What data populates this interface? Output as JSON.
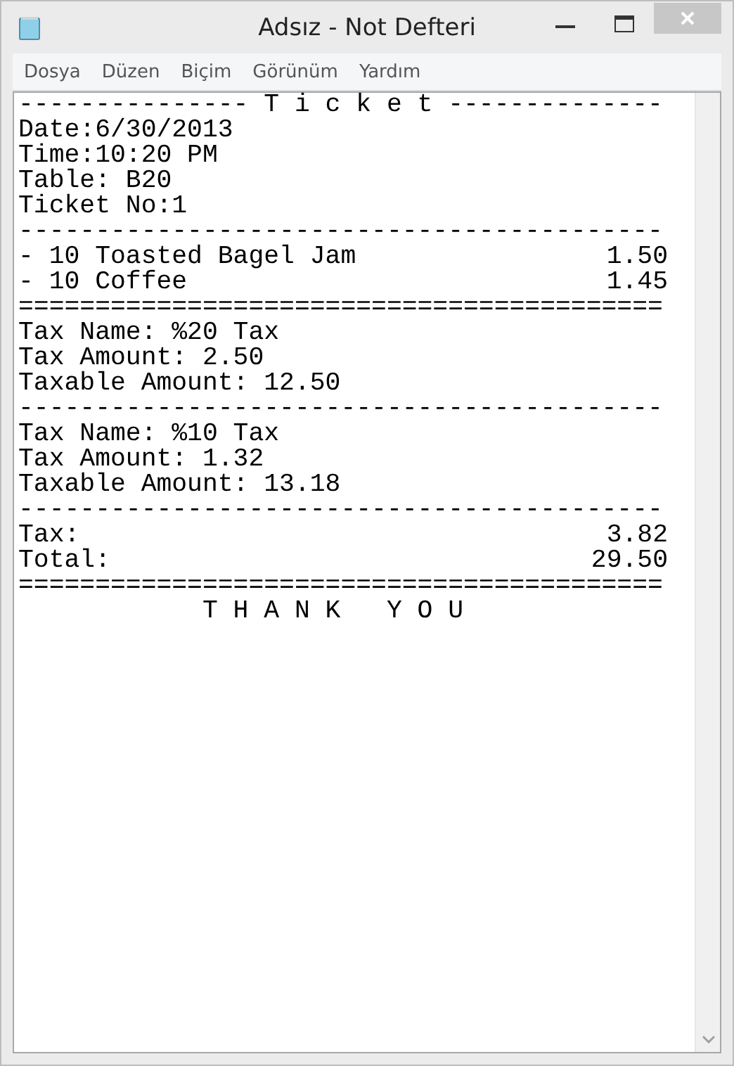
{
  "window": {
    "title": "Adsız - Not Defteri"
  },
  "menu": [
    "Dosya",
    "Düzen",
    "Biçim",
    "Görünüm",
    "Yardım"
  ],
  "document": {
    "lines": [
      {
        "kind": "text",
        "text": "--------------- T i c k e t --------------"
      },
      {
        "kind": "text",
        "text": "Date:6/30/2013"
      },
      {
        "kind": "text",
        "text": "Time:10:20 PM"
      },
      {
        "kind": "text",
        "text": "Table: B20"
      },
      {
        "kind": "text",
        "text": "Ticket No:1"
      },
      {
        "kind": "rule",
        "text": "------------------------------------------"
      },
      {
        "kind": "row",
        "label": "- 10 Toasted Bagel Jam",
        "amount": "1.50"
      },
      {
        "kind": "row",
        "label": "- 10 Coffee",
        "amount": "1.45"
      },
      {
        "kind": "rule",
        "text": "=========================================="
      },
      {
        "kind": "text",
        "text": "Tax Name: %20 Tax"
      },
      {
        "kind": "text",
        "text": "Tax Amount: 2.50"
      },
      {
        "kind": "text",
        "text": "Taxable Amount: 12.50"
      },
      {
        "kind": "rule",
        "text": "------------------------------------------"
      },
      {
        "kind": "text",
        "text": "Tax Name: %10 Tax"
      },
      {
        "kind": "text",
        "text": "Tax Amount: 1.32"
      },
      {
        "kind": "text",
        "text": "Taxable Amount: 13.18"
      },
      {
        "kind": "rule",
        "text": "------------------------------------------"
      },
      {
        "kind": "row",
        "label": "Tax:",
        "amount": "3.82"
      },
      {
        "kind": "row",
        "label": "Total:",
        "amount": "29.50"
      },
      {
        "kind": "rule",
        "text": "=========================================="
      },
      {
        "kind": "text",
        "text": "            T H A N K   Y O U"
      }
    ]
  }
}
